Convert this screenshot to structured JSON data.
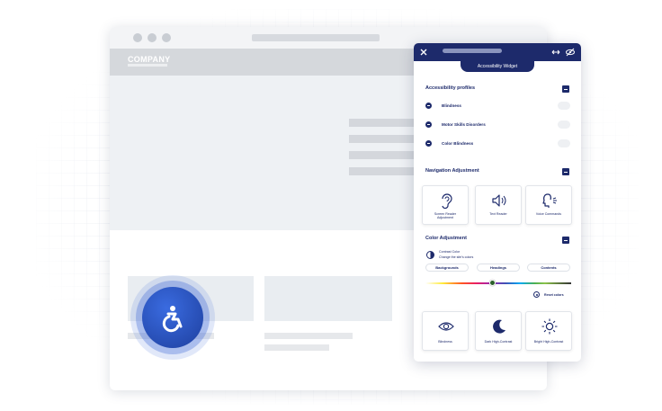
{
  "site": {
    "logo": "COMPANY"
  },
  "widget": {
    "title": "Accessibility Widget",
    "sections": {
      "profiles": {
        "title": "Accessibility profiles",
        "items": [
          {
            "label": "Blindness",
            "icon": "plus-circle-icon"
          },
          {
            "label": "Motor Skills Disorders",
            "icon": "plus-circle-icon"
          },
          {
            "label": "Color Blindness",
            "icon": "plus-circle-icon"
          }
        ]
      },
      "navigation": {
        "title": "Navigation Adjustment",
        "tiles": [
          {
            "label_1": "Screen Reader",
            "label_2": "Adjustment",
            "icon": "ear-icon"
          },
          {
            "label_1": "Text Reader",
            "label_2": "",
            "icon": "speaker-icon"
          },
          {
            "label_1": "Voice Commands",
            "label_2": "",
            "icon": "head-voice-icon"
          }
        ]
      },
      "color": {
        "title": "Color Adjustment",
        "contrast_title": "Contrast Color",
        "contrast_sub": "Change the site's colors",
        "targets": [
          "Backgrounds",
          "Headings",
          "Contents"
        ],
        "reset_label": "Reset colors",
        "tiles": [
          {
            "label": "Blindness",
            "icon": "eye-icon"
          },
          {
            "label": "Dark High-Contrast",
            "icon": "moon-icon"
          },
          {
            "label": "Bright High-Contrast",
            "icon": "sun-icon"
          }
        ]
      }
    }
  },
  "colors": {
    "primary": "#1d2a6b",
    "fab": "#2a58c8"
  }
}
